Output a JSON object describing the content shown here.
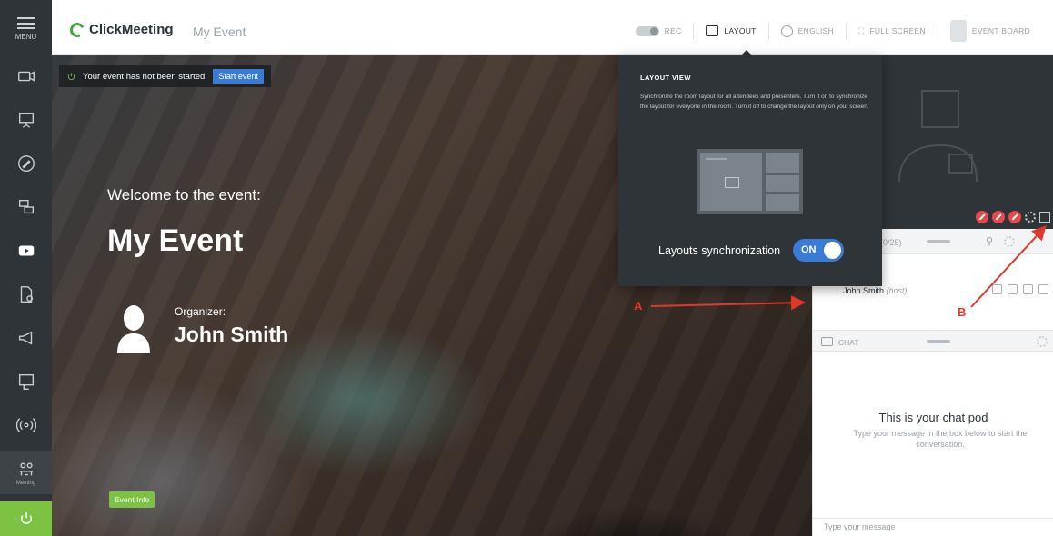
{
  "sidebar": {
    "menu_label": "MENU",
    "items": [
      {
        "icon": "camera-icon"
      },
      {
        "icon": "presentation-icon"
      },
      {
        "icon": "whiteboard-icon"
      },
      {
        "icon": "screen-share-icon"
      },
      {
        "icon": "youtube-icon"
      },
      {
        "icon": "file-icon"
      },
      {
        "icon": "megaphone-icon"
      },
      {
        "icon": "poll-icon"
      },
      {
        "icon": "broadcast-icon"
      },
      {
        "icon": "meeting-icon",
        "label": "Meeting"
      }
    ],
    "power_icon": "power-icon",
    "power_color": "#7dc243"
  },
  "topbar": {
    "logo": "ClickMeeting",
    "event_name": "My Event",
    "tools": {
      "rec": "REC",
      "layout": "LAYOUT",
      "english": "ENGLISH",
      "full_screen": "FULL SCREEN",
      "event_board": "EVENT BOARD"
    }
  },
  "stage": {
    "status_text": "Your event has not been started",
    "start_button": "Start event",
    "welcome": "Welcome to the event:",
    "title": "My Event",
    "organizer_label": "Organizer:",
    "organizer_name": "John Smith",
    "event_info_button": "Event Info"
  },
  "popover": {
    "title": "LAYOUT VIEW",
    "description": "Synchronize the room layout for all attendees and presenters. Turn it on to synchronize the layout for everyone in the room. Turn it off to change the layout only on your screen.",
    "sync_label": "Layouts synchronization",
    "toggle_state": "ON"
  },
  "right_panel": {
    "attendees_count": "(0/25)",
    "attendee": {
      "name": "John Smith",
      "role": "(host)"
    },
    "chat_label": "CHAT",
    "chat_title": "This is your chat pod",
    "chat_subtitle": "Type your message in the box below to start the conversation.",
    "chat_placeholder": "Type your message"
  },
  "annotations": {
    "a": "A",
    "b": "B",
    "color": "#e2382c"
  }
}
